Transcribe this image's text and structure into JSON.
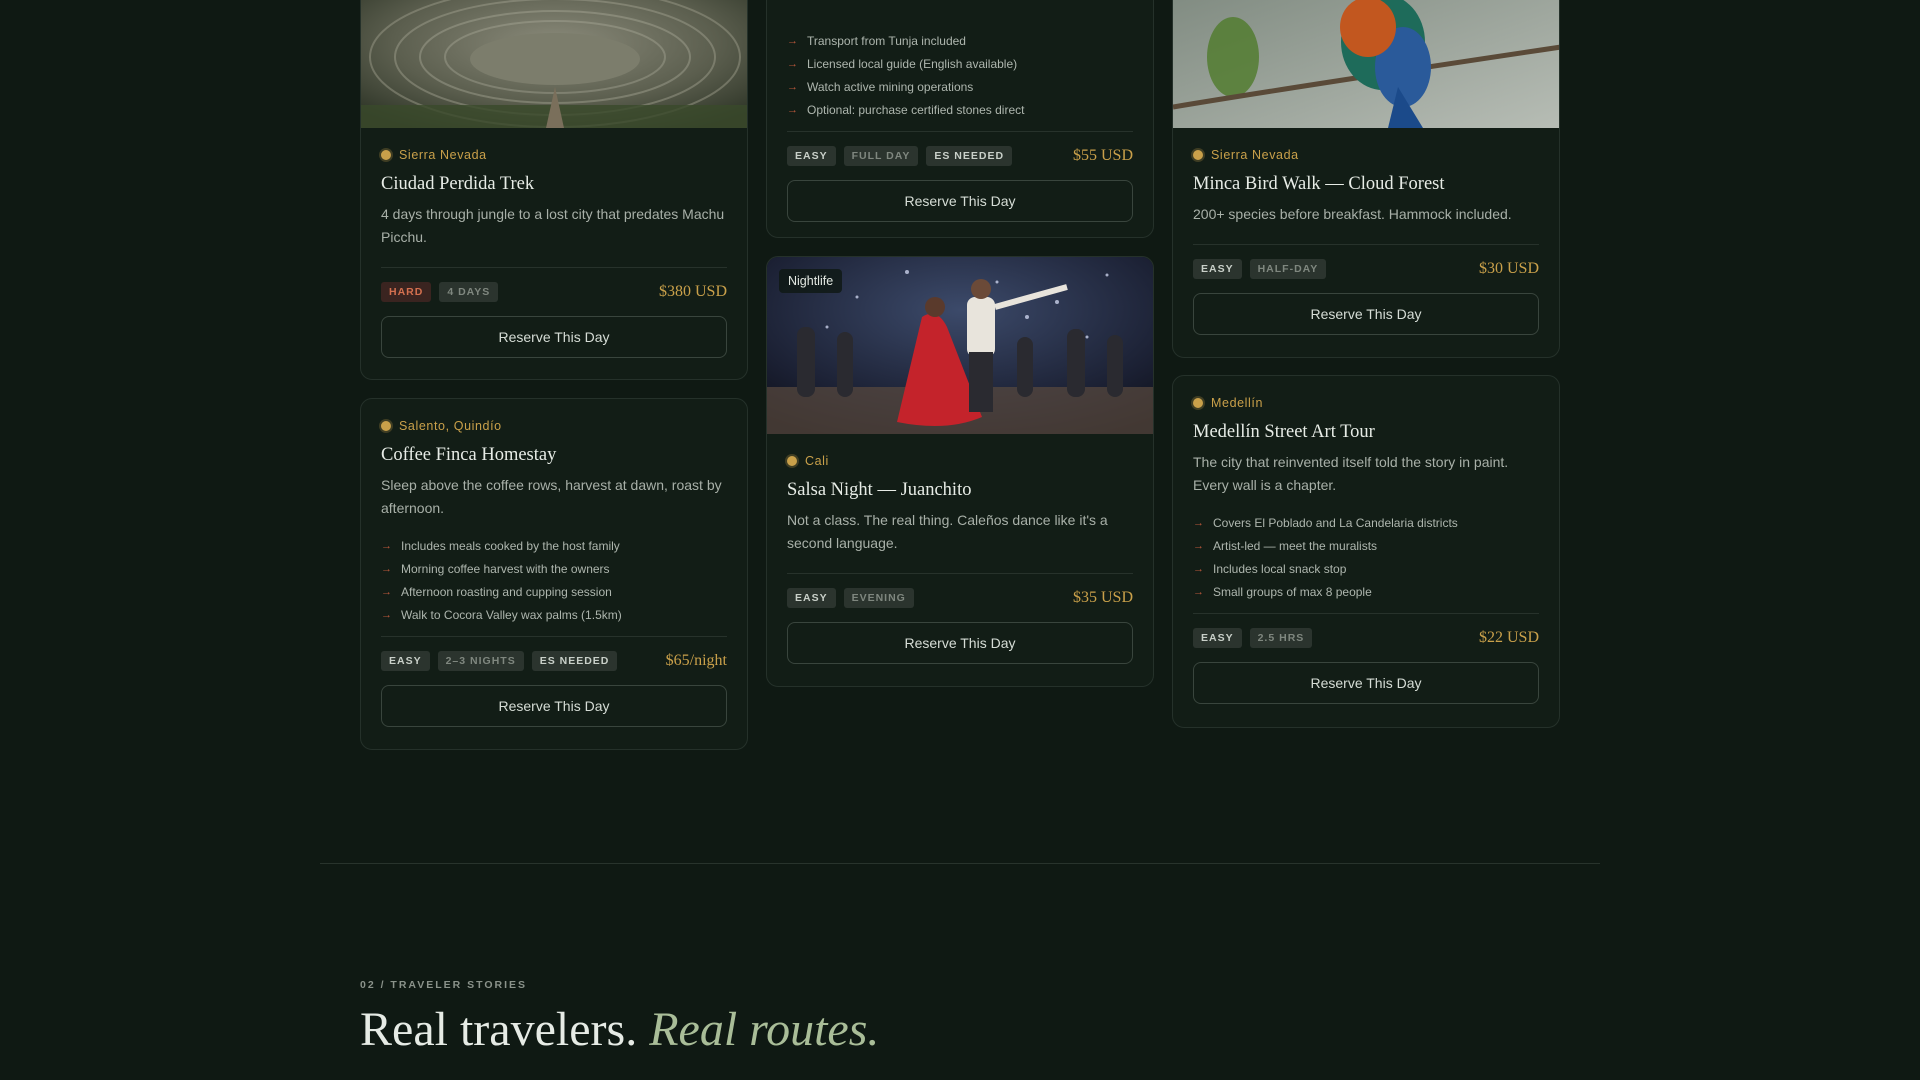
{
  "cards": {
    "ciudad": {
      "location": "Sierra Nevada",
      "title": "Ciudad Perdida Trek",
      "desc": "4 days through jungle to a lost city that predates Machu Picchu.",
      "tags": [
        "HARD",
        "4 DAYS"
      ],
      "price": "$380 USD",
      "cta": "Reserve This Day"
    },
    "coffee": {
      "location": "Salento, Quindío",
      "title": "Coffee Finca Homestay",
      "desc": "Sleep above the coffee rows, harvest at dawn, roast by afternoon.",
      "features": [
        "Includes meals cooked by the host family",
        "Morning coffee harvest with the owners",
        "Afternoon roasting and cupping session",
        "Walk to Cocora Valley wax palms (1.5km)"
      ],
      "tags": [
        "EASY",
        "2–3 NIGHTS",
        "ES NEEDED"
      ],
      "price": "$65/night",
      "cta": "Reserve This Day"
    },
    "emerald": {
      "features": [
        "Transport from Tunja included",
        "Licensed local guide (English available)",
        "Watch active mining operations",
        "Optional: purchase certified stones direct"
      ],
      "tags": [
        "EASY",
        "FULL DAY",
        "ES NEEDED"
      ],
      "price": "$55 USD",
      "cta": "Reserve This Day"
    },
    "salsa": {
      "badge": "Nightlife",
      "location": "Cali",
      "title": "Salsa Night — Juanchito",
      "desc": "Not a class. The real thing. Caleños dance like it's a second language.",
      "tags": [
        "EASY",
        "EVENING"
      ],
      "price": "$35 USD",
      "cta": "Reserve This Day"
    },
    "minca": {
      "location": "Sierra Nevada",
      "title": "Minca Bird Walk — Cloud Forest",
      "desc": "200+ species before breakfast. Hammock included.",
      "tags": [
        "EASY",
        "HALF-DAY"
      ],
      "price": "$30 USD",
      "cta": "Reserve This Day"
    },
    "medellin": {
      "location": "Medellín",
      "title": "Medellín Street Art Tour",
      "desc": "The city that reinvented itself told the story in paint. Every wall is a chapter.",
      "features": [
        "Covers El Poblado and La Candelaria districts",
        "Artist-led — meet the muralists",
        "Includes local snack stop",
        "Small groups of max 8 people"
      ],
      "tags": [
        "EASY",
        "2.5 HRS"
      ],
      "price": "$22 USD",
      "cta": "Reserve This Day"
    }
  },
  "stories": {
    "eyebrow": "02 / TRAVELER STORIES",
    "headline_plain": "Real travelers.",
    "headline_em": "Real routes."
  },
  "colors": {
    "background": "#0f1913",
    "accent_gold": "#c9a04a",
    "accent_rust": "#b9573b",
    "headline_green": "#a9bd98"
  }
}
